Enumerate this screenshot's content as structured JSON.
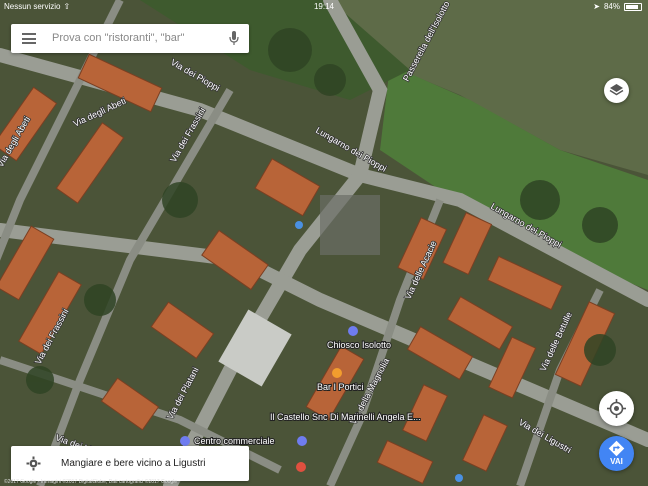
{
  "status_bar": {
    "carrier": "Nessun servizio",
    "time": "19:14",
    "battery": "84%",
    "battery_level": 0.84
  },
  "search": {
    "placeholder": "Prova con \"ristoranti\", \"bar\""
  },
  "map": {
    "streets": [
      "Lungarno dei Pioppi",
      "Lungarno dei Pioppi",
      "Passerella dell'Isolotto",
      "Via dei Pioppi",
      "Via degli Abeti",
      "Via degli Abeti",
      "Via dei Frassini",
      "Via delle Acacie",
      "Via dei Frassini",
      "Via dei Platani",
      "Via dei Ligustri",
      "Via delle Betulle",
      "Via della Magnolia",
      "Via dei Ligustri"
    ],
    "pois": [
      {
        "name": "Chiosco Isolotto",
        "icon": "shopping-bag-icon"
      },
      {
        "name": "Bar I Portici",
        "icon": "cocktail-icon"
      },
      {
        "name": "Il Castello Snc Di Marinelli Angela E...",
        "icon": "shopping-bag-icon"
      },
      {
        "name": "Centro commerciale",
        "icon": "shopping-bag-icon"
      }
    ]
  },
  "bottom_sheet": {
    "label": "Mangiare e bere vicino a Ligustri"
  },
  "buttons": {
    "go_label": "VAI"
  },
  "attribution": "©2017 Google · Immagini ©2017 DigitalGlobe, Dati cartografici ©2017 Google"
}
